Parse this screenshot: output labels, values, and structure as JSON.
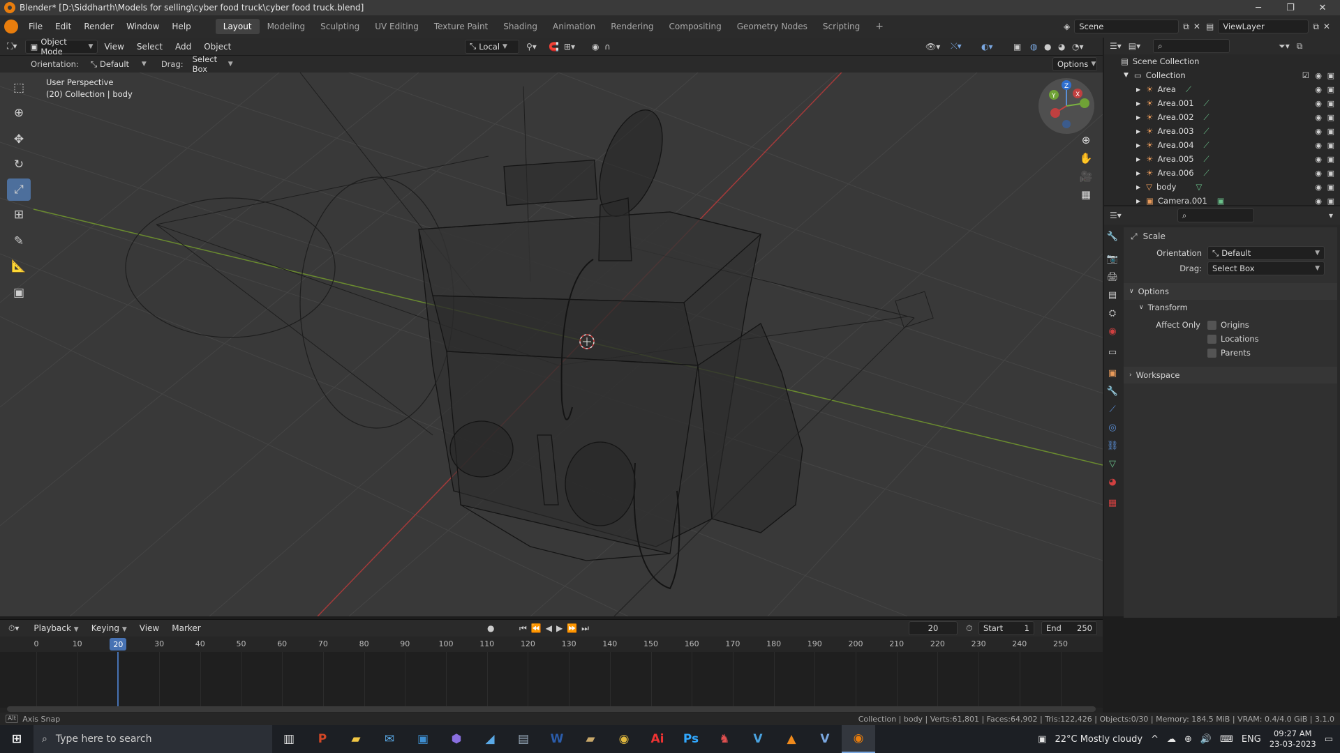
{
  "window": {
    "title": "Blender* [D:\\Siddharth\\Models for selling\\cyber food truck\\cyber food truck.blend]"
  },
  "menu": [
    "File",
    "Edit",
    "Render",
    "Window",
    "Help"
  ],
  "workspaces": [
    "Layout",
    "Modeling",
    "Sculpting",
    "UV Editing",
    "Texture Paint",
    "Shading",
    "Animation",
    "Rendering",
    "Compositing",
    "Geometry Nodes",
    "Scripting"
  ],
  "active_workspace": "Layout",
  "scene": {
    "name": "Scene",
    "view_layer": "ViewLayer"
  },
  "header": {
    "mode": "Object Mode",
    "menus": [
      "View",
      "Select",
      "Add",
      "Object"
    ],
    "pivot": "Local"
  },
  "tool_settings": {
    "orientation_label": "Orientation:",
    "orientation": "Default",
    "drag_label": "Drag:",
    "drag": "Select Box",
    "options": "Options"
  },
  "viewport": {
    "perspective": "User Perspective",
    "collection_info": "(20) Collection | body"
  },
  "gizmo": {
    "x": "X",
    "y": "Y",
    "z": "Z"
  },
  "outliner": {
    "root": "Scene Collection",
    "collection": "Collection",
    "items": [
      "Area",
      "Area.001",
      "Area.002",
      "Area.003",
      "Area.004",
      "Area.005",
      "Area.006",
      "body",
      "Camera.001"
    ]
  },
  "properties": {
    "tool_name": "Scale",
    "orientation_label": "Orientation",
    "orientation": "Default",
    "drag_label": "Drag:",
    "drag": "Select Box",
    "options_label": "Options",
    "transform_label": "Transform",
    "affect_only_label": "Affect Only",
    "checkboxes": [
      "Origins",
      "Locations",
      "Parents"
    ],
    "workspace_label": "Workspace"
  },
  "timeline": {
    "menus": [
      "Playback",
      "Keying",
      "View",
      "Marker"
    ],
    "current_frame": "20",
    "start_label": "Start",
    "start": "1",
    "end_label": "End",
    "end": "250",
    "ticks": [
      "0",
      "10",
      "20",
      "30",
      "40",
      "50",
      "60",
      "70",
      "80",
      "90",
      "100",
      "110",
      "120",
      "130",
      "140",
      "150",
      "160",
      "170",
      "180",
      "190",
      "200",
      "210",
      "220",
      "230",
      "240",
      "250"
    ]
  },
  "status": {
    "left": "Axis Snap",
    "right": "Collection | body | Verts:61,801 | Faces:64,902 | Tris:122,426 | Objects:0/30 | Memory: 184.5 MiB | VRAM: 0.4/4.0 GiB | 3.1.0"
  },
  "taskbar": {
    "search_placeholder": "Type here to search",
    "weather": "22°C  Mostly cloudy",
    "lang": "ENG",
    "time": "09:27 AM",
    "date": "23-03-2023"
  }
}
